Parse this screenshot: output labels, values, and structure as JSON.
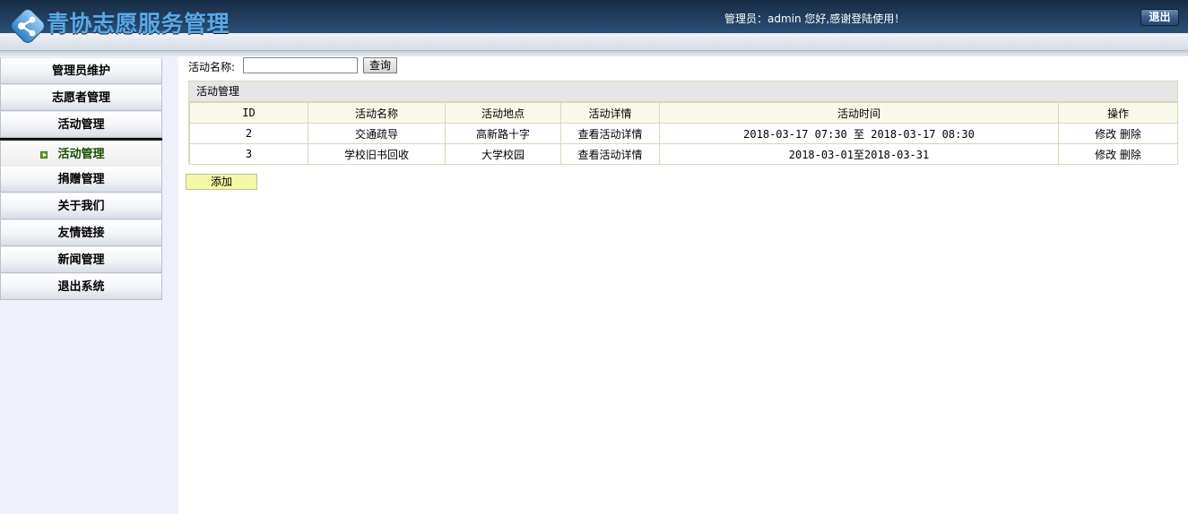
{
  "header": {
    "title": "青协志愿服务管理",
    "welcome": "管理员：admin 您好,感谢登陆使用！",
    "logout_label": "退出",
    "logo_icon": "share-nodes-icon"
  },
  "sidebar": {
    "items": [
      {
        "label": "管理员维护"
      },
      {
        "label": "志愿者管理"
      },
      {
        "label": "活动管理"
      }
    ],
    "sub_item": {
      "label": "活动管理"
    },
    "items_after": [
      {
        "label": "捐赠管理"
      },
      {
        "label": "关于我们"
      },
      {
        "label": "友情链接"
      },
      {
        "label": "新闻管理"
      },
      {
        "label": "退出系统"
      }
    ]
  },
  "search": {
    "label": "活动名称:",
    "value": "",
    "button_label": "查询"
  },
  "panel": {
    "title": "活动管理",
    "columns": [
      "ID",
      "活动名称",
      "活动地点",
      "活动详情",
      "活动时间",
      "操作"
    ],
    "rows": [
      {
        "id": "2",
        "name": "交通疏导",
        "location": "高新路十字",
        "detail": "查看活动详情",
        "time": "2018-03-17 07:30 至 2018-03-17 08:30",
        "edit": "修改",
        "delete": "删除"
      },
      {
        "id": "3",
        "name": "学校旧书回收",
        "location": "大学校园",
        "detail": "查看活动详情",
        "time": "2018-03-01至2018-03-31",
        "edit": "修改",
        "delete": "删除"
      }
    ]
  },
  "add_button_label": "添加"
}
